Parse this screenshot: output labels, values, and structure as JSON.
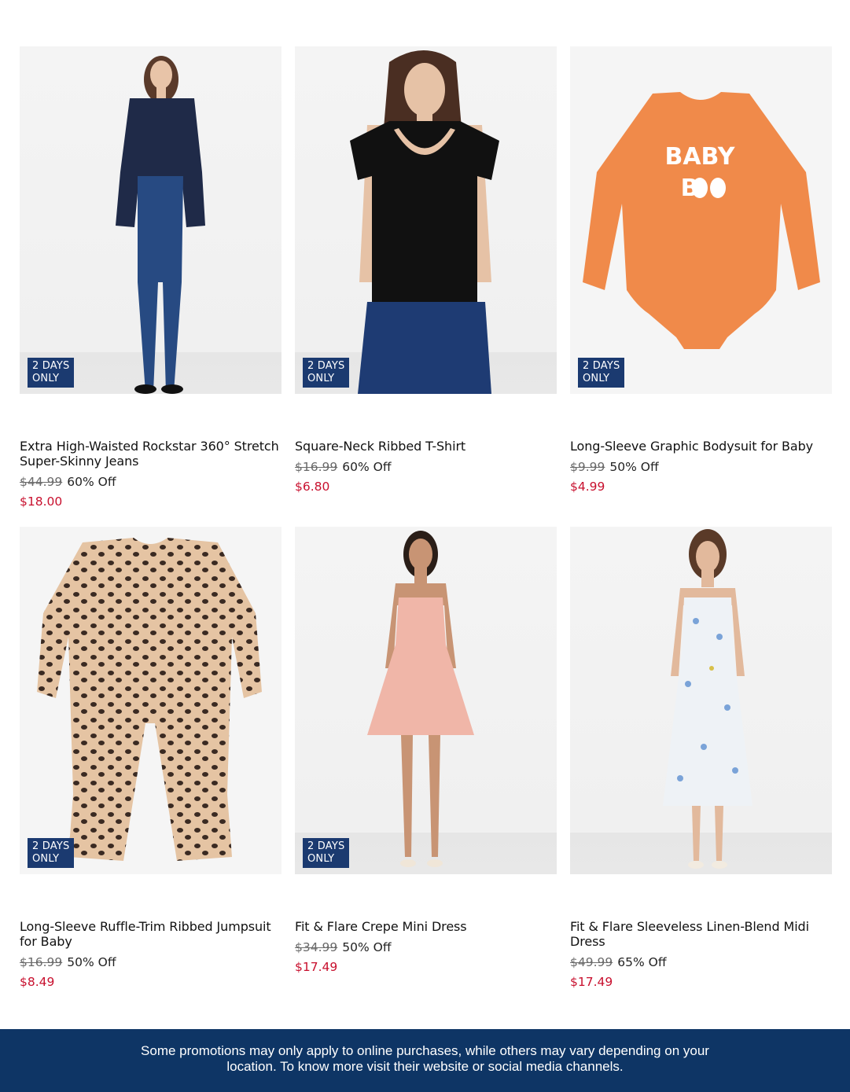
{
  "badge_text": [
    "2 DAYS",
    "ONLY"
  ],
  "products": [
    {
      "name": "Extra High-Waisted Rockstar 360° Stretch Super-Skinny Jeans",
      "original_price": "$44.99",
      "discount": "60% Off",
      "sale_price": "$18.00",
      "badge": true
    },
    {
      "name": "Square-Neck Ribbed T-Shirt",
      "original_price": "$16.99",
      "discount": "60% Off",
      "sale_price": "$6.80",
      "badge": true
    },
    {
      "name": "Long-Sleeve Graphic Bodysuit for Baby",
      "original_price": "$9.99",
      "discount": "50% Off",
      "sale_price": "$4.99",
      "badge": true,
      "graphic_text": "BABY BOO"
    },
    {
      "name": "Long-Sleeve Ruffle-Trim Ribbed Jumpsuit for Baby",
      "original_price": "$16.99",
      "discount": "50% Off",
      "sale_price": "$8.49",
      "badge": true
    },
    {
      "name": "Fit & Flare Crepe Mini Dress",
      "original_price": "$34.99",
      "discount": "50% Off",
      "sale_price": "$17.49",
      "badge": true
    },
    {
      "name": "Fit & Flare Sleeveless Linen-Blend Midi Dress",
      "original_price": "$49.99",
      "discount": "65% Off",
      "sale_price": "$17.49",
      "badge": false
    }
  ],
  "footer": {
    "notice": "Some promotions may only apply to online purchases, while others may vary depending on your location. To know more visit their website or social media channels."
  },
  "colors": {
    "sale_red": "#c8102e",
    "badge_navy": "#1b3a70",
    "footer_navy": "#0e3565"
  }
}
